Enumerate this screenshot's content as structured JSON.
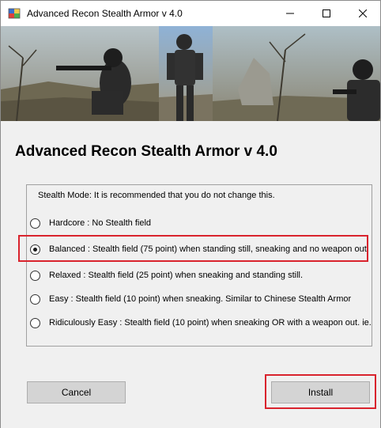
{
  "window": {
    "title": "Advanced Recon Stealth Armor v 4.0",
    "icon": "app-icon",
    "controls": [
      "minimize-icon",
      "maximize-icon",
      "close-icon"
    ]
  },
  "banner": {
    "description_icon": "banner-image"
  },
  "main": {
    "heading": "Advanced Recon Stealth Armor v 4.0",
    "group_label": "Stealth Mode: It is recommended that you do not change this.",
    "options": [
      {
        "label": "Hardcore : No Stealth field",
        "checked": false
      },
      {
        "label": "Balanced : Stealth field (75 point) when standing still, sneaking and no weapon out",
        "checked": true
      },
      {
        "label": "Relaxed : Stealth field (25 point) when sneaking and standing still.",
        "checked": false
      },
      {
        "label": "Easy : Stealth field (10 point) when sneaking. Similar to Chinese Stealth Armor",
        "checked": false
      },
      {
        "label": "Ridiculously Easy : Stealth field (10 point) when sneaking OR with a weapon out. ie. Pr",
        "checked": false
      }
    ]
  },
  "buttons": {
    "cancel": "Cancel",
    "install": "Install"
  },
  "colors": {
    "highlight": "#d9232d",
    "background": "#f0f0f0"
  }
}
